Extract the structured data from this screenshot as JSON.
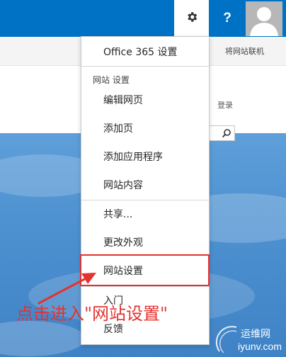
{
  "top_bar": {
    "help_label": "?",
    "accent_color": "#0072c6"
  },
  "ribbon": {
    "sync_label": "将网站联机"
  },
  "page": {
    "login_label": "登录"
  },
  "settings_menu": {
    "office365_label": "Office 365 设置",
    "site_settings_header": "网站 设置",
    "items": {
      "edit_page": "编辑网页",
      "add_page": "添加页",
      "add_app": "添加应用程序",
      "site_contents": "网站内容",
      "share": "共享...",
      "change_look": "更改外观",
      "site_settings": "网站设置",
      "getting_started": "入门",
      "feedback": "反馈"
    }
  },
  "annotation": {
    "text": "点击进入\"网站设置\"",
    "color": "#e5322f"
  },
  "watermark": {
    "line1": "运维网",
    "line2": "iyunv.com"
  },
  "icons": {
    "gear": "gear-icon",
    "avatar": "user-silhouette-icon",
    "search": "search-icon",
    "arrow": "arrow-icon"
  }
}
